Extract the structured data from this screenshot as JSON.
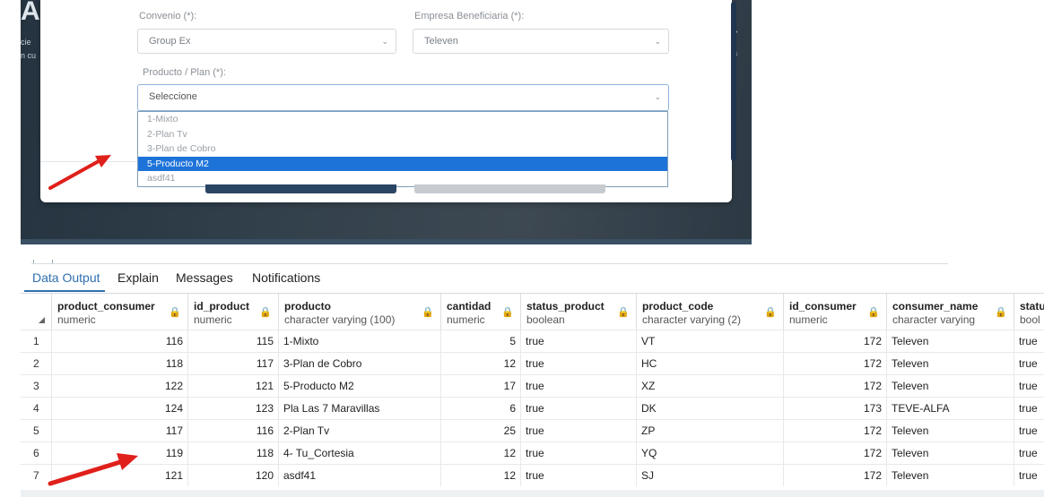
{
  "form": {
    "convenio_label": "Convenio (*):",
    "convenio_value": "Group Ex",
    "empresa_label": "Empresa Beneficiaria (*):",
    "empresa_value": "Televen",
    "producto_label": "Producto / Plan (*):",
    "producto_placeholder": "Seleccione",
    "dropdown_options": [
      "1-Mixto",
      "2-Plan Tv",
      "3-Plan de Cobro",
      "5-Producto M2",
      "asdf41"
    ],
    "selected_option": "5-Producto M2"
  },
  "result_panel": {
    "tabs": [
      "Data Output",
      "Explain",
      "Messages",
      "Notifications"
    ],
    "active_tab": "Data Output",
    "columns": [
      {
        "name": "product_consumer",
        "type": "numeric"
      },
      {
        "name": "id_product",
        "type": "numeric"
      },
      {
        "name": "producto",
        "type": "character varying (100)"
      },
      {
        "name": "cantidad",
        "type": "numeric"
      },
      {
        "name": "status_product",
        "type": "boolean"
      },
      {
        "name": "product_code",
        "type": "character varying (2)"
      },
      {
        "name": "id_consumer",
        "type": "numeric"
      },
      {
        "name": "consumer_name",
        "type": "character varying"
      },
      {
        "name": "statu",
        "type": "bool"
      }
    ],
    "rows": [
      [
        "1",
        "116",
        "115",
        "1-Mixto",
        "5",
        "true",
        "VT",
        "172",
        "Televen",
        "true"
      ],
      [
        "2",
        "118",
        "117",
        "3-Plan de Cobro",
        "12",
        "true",
        "HC",
        "172",
        "Televen",
        "true"
      ],
      [
        "3",
        "122",
        "121",
        "5-Producto M2",
        "17",
        "true",
        "XZ",
        "172",
        "Televen",
        "true"
      ],
      [
        "4",
        "124",
        "123",
        "Pla Las 7 Maravillas",
        "6",
        "true",
        "DK",
        "173",
        "TEVE-ALFA",
        "true"
      ],
      [
        "5",
        "117",
        "116",
        "2-Plan Tv",
        "25",
        "true",
        "ZP",
        "172",
        "Televen",
        "true"
      ],
      [
        "6",
        "119",
        "118",
        "4- Tu_Cortesia",
        "12",
        "true",
        "YQ",
        "172",
        "Televen",
        "true"
      ],
      [
        "7",
        "121",
        "120",
        "asdf41",
        "12",
        "true",
        "SJ",
        "172",
        "Televen",
        "true"
      ]
    ]
  },
  "colors": {
    "selection_blue": "#1e73d9",
    "annotation_red": "#e0201b",
    "tab_active": "#2f6fb0"
  }
}
